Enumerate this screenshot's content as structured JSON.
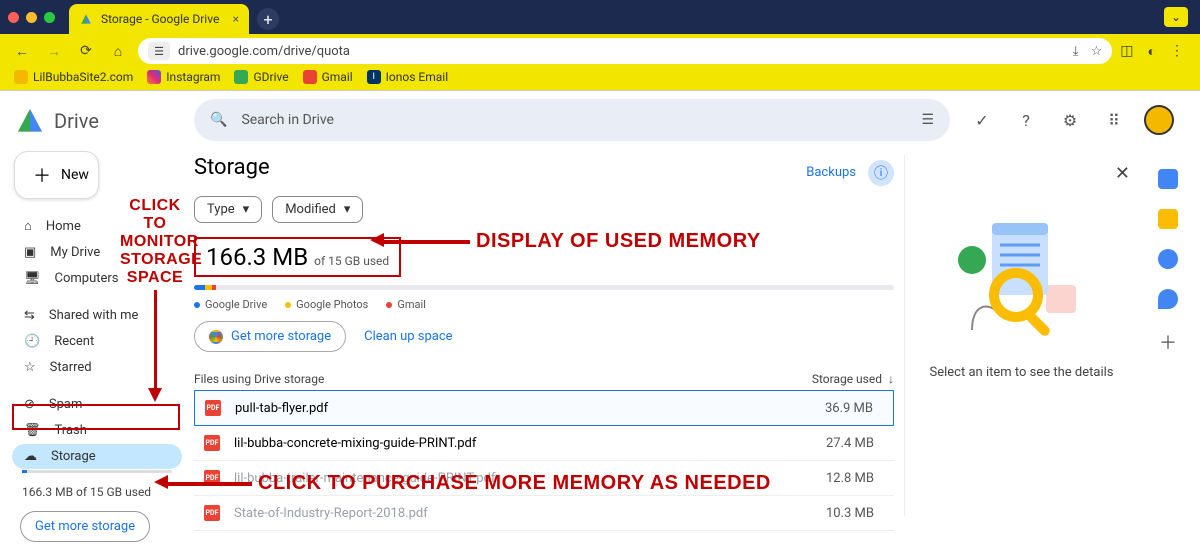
{
  "browser": {
    "tab_title": "Storage - Google Drive",
    "url": "drive.google.com/drive/quota"
  },
  "bookmarks": [
    "LilBubbaSite2.com",
    "Instagram",
    "GDrive",
    "Gmail",
    "Ionos Email"
  ],
  "brand": "Drive",
  "search_placeholder": "Search in Drive",
  "new_button": "New",
  "nav": {
    "home": "Home",
    "mydrive": "My Drive",
    "computers": "Computers",
    "shared": "Shared with me",
    "recent": "Recent",
    "starred": "Starred",
    "spam": "Spam",
    "trash": "Trash",
    "storage": "Storage"
  },
  "sidebar_storage_text": "166.3 MB of 15 GB used",
  "sidebar_more_btn": "Get more storage",
  "main": {
    "title": "Storage",
    "backups": "Backups",
    "chip_type": "Type",
    "chip_modified": "Modified",
    "used_amount": "166.3 MB",
    "used_total": "of 15 GB used",
    "legend": {
      "drive": "Google Drive",
      "photos": "Google Photos",
      "gmail": "Gmail"
    },
    "get_more": "Get more storage",
    "clean": "Clean up space",
    "list_header_name": "Files using Drive storage",
    "list_header_size": "Storage used"
  },
  "files": [
    {
      "name": "pull-tab-flyer.pdf",
      "size": "36.9 MB",
      "selected": true,
      "dim": false
    },
    {
      "name": "lil-bubba-concrete-mixing-guide-PRINT.pdf",
      "size": "27.4 MB",
      "selected": false,
      "dim": false
    },
    {
      "name": "lil-bubba-trailer-maintenance-guide-PRINT.pdf",
      "size": "12.8 MB",
      "selected": false,
      "dim": true
    },
    {
      "name": "State-of-Industry-Report-2018.pdf",
      "size": "10.3 MB",
      "selected": false,
      "dim": true
    }
  ],
  "details_msg": "Select an item to see the details",
  "annotations": {
    "monitor": "CLICK TO MONITOR STORAGE SPACE",
    "display": "DISPLAY OF USED MEMORY",
    "purchase": "CLICK TO PURCHASE MORE MEMORY AS NEEDED"
  }
}
